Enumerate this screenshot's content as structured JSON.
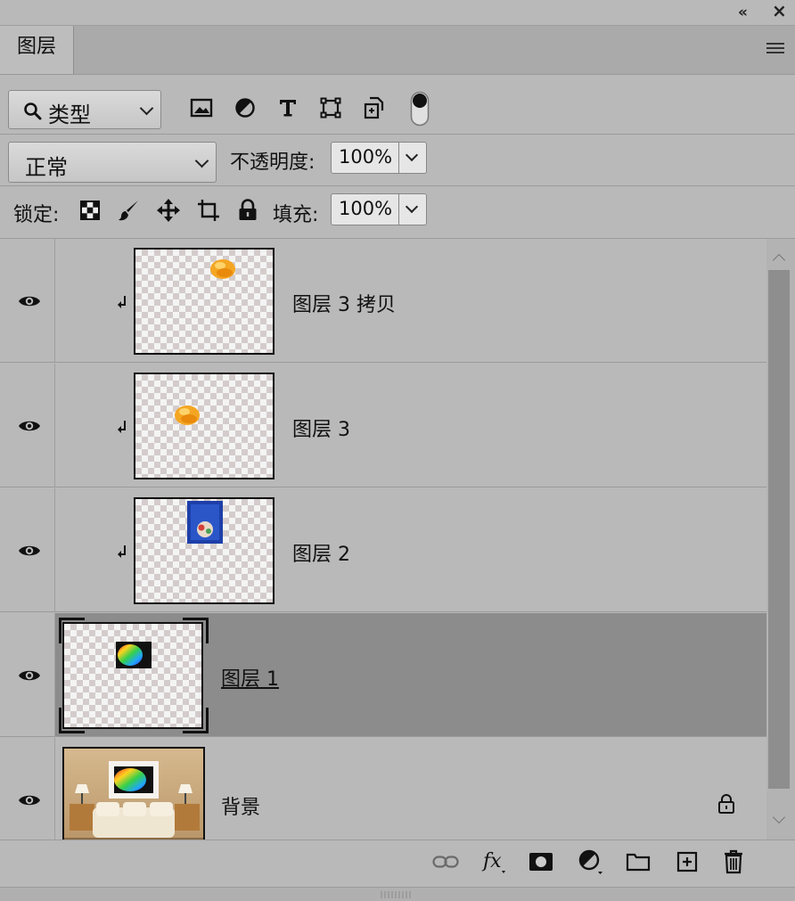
{
  "window": {
    "collapse_glyph": "«",
    "close_glyph": "×"
  },
  "tab": {
    "label": "图层"
  },
  "filter": {
    "kind_label": "类型",
    "icons": [
      "image-filter-icon",
      "adjustment-filter-icon",
      "text-filter-icon",
      "shape-filter-icon",
      "smart-object-filter-icon",
      "filter-toggle-icon"
    ]
  },
  "blend": {
    "mode": "正常",
    "opacity_label": "不透明度:",
    "opacity_value": "100%"
  },
  "lock": {
    "label": "锁定:",
    "fill_label": "填充:",
    "fill_value": "100%"
  },
  "layers": [
    {
      "name": "图层 3 拷贝",
      "visible": true,
      "clipped": true,
      "thumb": "orange-blob",
      "selected": false
    },
    {
      "name": "图层 3",
      "visible": true,
      "clipped": true,
      "thumb": "orange-blob",
      "selected": false
    },
    {
      "name": "图层 2",
      "visible": true,
      "clipped": true,
      "thumb": "blue-artwork",
      "selected": false
    },
    {
      "name": "图层 1",
      "visible": true,
      "clipped": false,
      "thumb": "rainbow-rect",
      "selected": true
    },
    {
      "name": "背景",
      "visible": true,
      "clipped": false,
      "thumb": "living-room-photo",
      "locked": true,
      "selected": false
    }
  ],
  "footer_icons": [
    "link-layers-icon",
    "fx-icon",
    "mask-icon",
    "adjustment-layer-icon",
    "group-folder-icon",
    "new-layer-icon",
    "trash-icon"
  ],
  "colors": {
    "panel_bg": "#b9b9b9",
    "selected_row": "#8c8c8c",
    "tab_bg": "#bdbdbd"
  }
}
